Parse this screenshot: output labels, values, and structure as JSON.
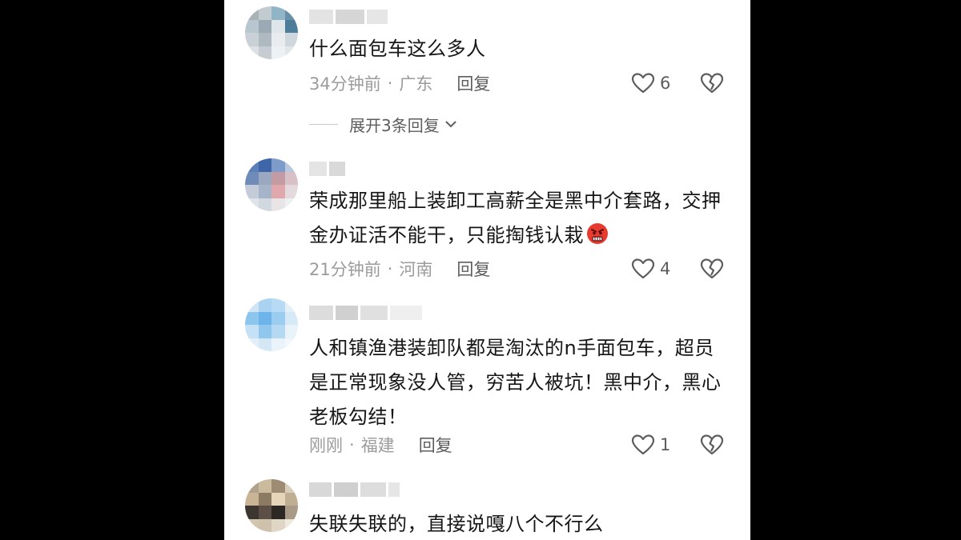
{
  "comments": [
    {
      "text": "什么面包车这么多人",
      "time": "34分钟前",
      "location": "广东",
      "reply_label": "回复",
      "likes": "6",
      "expand_label": "展开3条回复"
    },
    {
      "text": "荣成那里船上装卸工高薪全是黑中介套路，交押金办证活不能干，只能掏钱认栽",
      "emoji": "angry-face-icon",
      "time": "21分钟前",
      "location": "河南",
      "reply_label": "回复",
      "likes": "4"
    },
    {
      "text": "人和镇渔港装卸队都是淘汰的n手面包车，超员是正常现象没人管，穷苦人被坑！黑中介，黑心老板勾结！",
      "time": "刚刚",
      "location": "福建",
      "reply_label": "回复",
      "likes": "1"
    },
    {
      "text": "失联失联的，直接说嘎八个不行么"
    }
  ],
  "meta_separator": "·",
  "colors": {
    "background_outer": "#000000",
    "panel": "#ffffff",
    "text_primary": "#161616",
    "text_meta": "#9b9b9b",
    "text_action": "#5d5d5d"
  }
}
